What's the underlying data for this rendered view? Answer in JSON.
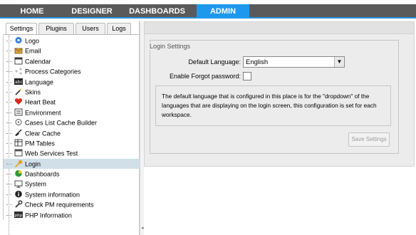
{
  "top_nav": {
    "items": [
      {
        "label": "HOME",
        "active": false
      },
      {
        "label": "DESIGNER",
        "active": false
      },
      {
        "label": "DASHBOARDS",
        "active": false
      },
      {
        "label": "ADMIN",
        "active": true
      }
    ],
    "active_color": "#1e98ec",
    "bar_color": "#5a5a5a"
  },
  "left_panel": {
    "tabs": [
      {
        "label": "Settings",
        "active": true
      },
      {
        "label": "Plugins",
        "active": false
      },
      {
        "label": "Users",
        "active": false
      },
      {
        "label": "Logs",
        "active": false
      }
    ],
    "tree": [
      {
        "label": "Logo",
        "icon": "logo-gear-icon"
      },
      {
        "label": "Email",
        "icon": "email-icon"
      },
      {
        "label": "Calendar",
        "icon": "calendar-icon"
      },
      {
        "label": "Process Categories",
        "icon": "process-categories-icon"
      },
      {
        "label": "Language",
        "icon": "language-abc-icon"
      },
      {
        "label": "Skins",
        "icon": "skins-wand-icon"
      },
      {
        "label": "Heart Beat",
        "icon": "heart-icon"
      },
      {
        "label": "Environment",
        "icon": "environment-icon"
      },
      {
        "label": "Cases List Cache Builder",
        "icon": "cache-builder-icon"
      },
      {
        "label": "Clear Cache",
        "icon": "broom-icon"
      },
      {
        "label": "PM Tables",
        "icon": "pm-tables-icon"
      },
      {
        "label": "Web Services Test",
        "icon": "web-services-icon"
      },
      {
        "label": "Login",
        "icon": "key-icon",
        "selected": true
      },
      {
        "label": "Dashboards",
        "icon": "dashboards-icon"
      },
      {
        "label": "System",
        "icon": "monitor-icon"
      },
      {
        "label": "System information",
        "icon": "info-icon"
      },
      {
        "label": "Check PM requirements",
        "icon": "wrench-icon"
      },
      {
        "label": "PHP Information",
        "icon": "php-icon"
      }
    ]
  },
  "login_settings": {
    "legend": "Login Settings",
    "default_language_label": "Default Language:",
    "default_language_value": "English",
    "forgot_password_label": "Enable Forgot password:",
    "forgot_password_checked": false,
    "info_text": "The default language that is configured in this place is for the \"dropdown\" of the languages that are displaying on the login screen, this configuration is set for each workspace.",
    "save_button": "Save Settings"
  }
}
